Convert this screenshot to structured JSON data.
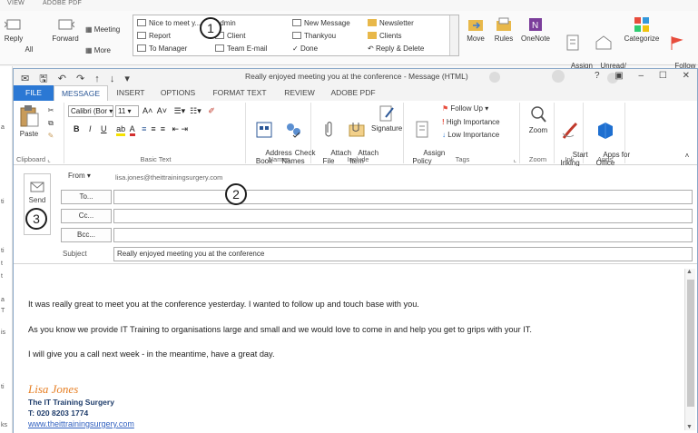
{
  "background_window": {
    "tabs": [
      "VIEW",
      "ADOBE PDF"
    ],
    "buttons": {
      "reply": "Reply",
      "reply_all": "All",
      "forward": "Forward",
      "meeting": "Meeting",
      "more": "More",
      "move": "Move",
      "rules": "Rules",
      "onenote": "OneNote",
      "assign_policy": "Assign\nPolicy",
      "unread_read": "Unread/\nRead",
      "categorize": "Categorize",
      "follow_up": "Follow\nUp"
    },
    "quick_steps": {
      "col1": [
        "Nice to meet y...",
        "Report",
        "To Manager"
      ],
      "col2": [
        "Admin",
        "Client",
        "Team E-mail"
      ],
      "col3": [
        "New Message",
        "Thankyou",
        "Done"
      ],
      "col4": [
        "Newsletter",
        "Clients",
        "Reply & Delete"
      ]
    },
    "left_fragments": [
      "a",
      "ti",
      "ti",
      "t",
      "t",
      "a",
      "T",
      "is",
      "ti",
      "ks"
    ]
  },
  "callouts": [
    "1",
    "2",
    "3"
  ],
  "message_window": {
    "title": "Really enjoyed meeting you at the conference - Message (HTML)",
    "controls": [
      "?",
      "▣",
      "–",
      "☐",
      "✕"
    ],
    "tabs": [
      "FILE",
      "MESSAGE",
      "INSERT",
      "OPTIONS",
      "FORMAT TEXT",
      "REVIEW",
      "ADOBE PDF"
    ],
    "ribbon": {
      "paste": "Paste",
      "clipboard": "Clipboard",
      "font_name": "Calibri (Bor",
      "font_size": "11",
      "basic_text": "Basic Text",
      "address_book": "Address\nBook",
      "check_names": "Check\nNames",
      "names": "Names",
      "attach_file": "Attach\nFile",
      "attach_item": "Attach\nItem",
      "signature": "Signature",
      "include": "Include",
      "assign_policy": "Assign\nPolicy",
      "follow_up": "Follow Up",
      "high_importance": "High Importance",
      "low_importance": "Low Importance",
      "tags": "Tags",
      "zoom": "Zoom",
      "zoom_group": "Zoom",
      "start_inking": "Start\nInking",
      "ink_group": "Ink",
      "apps_for_office": "Apps for\nOffice",
      "apps_group": "Apps"
    },
    "header": {
      "send": "Send",
      "from_label": "From",
      "from_value": "lisa.jones@theittrainingsurgery.com",
      "to_label": "To...",
      "cc_label": "Cc...",
      "bcc_label": "Bcc...",
      "subject_label": "Subject",
      "subject_value": "Really enjoyed meeting you at the conference",
      "to_value": "",
      "cc_value": "",
      "bcc_value": ""
    },
    "body": {
      "paragraphs": [
        "It was really great to meet you at the conference yesterday. I wanted to follow up and touch base with you.",
        "As you know we provide IT Training to organisations large and small and we would love to come in and help you get to grips with your IT.",
        "I will give you a call next week - in the meantime, have a great day."
      ],
      "signature": {
        "name": "Lisa Jones",
        "company": "The IT Training Surgery",
        "phone": "T: 020 8203 1774",
        "website": "www.theittrainingsurgery.com"
      }
    },
    "colors": {
      "file_tab": "#2b78d4",
      "signature_name": "#e67e22",
      "signature_text": "#1f3d6b",
      "link": "#2f5fbf"
    }
  }
}
